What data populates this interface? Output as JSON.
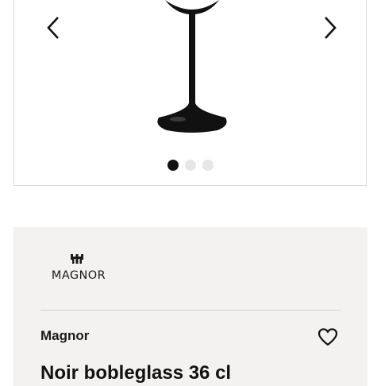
{
  "gallery": {
    "image_count": 3,
    "active_index": 0,
    "prev_icon": "chevron-left-icon",
    "next_icon": "chevron-right-icon"
  },
  "product": {
    "logo_text": "MAGNOR",
    "brand": "Magnor",
    "title": "Noir bobleglass 36 cl",
    "favorite_icon": "heart-outline-icon"
  },
  "colors": {
    "card_background": "#f4f2f1",
    "dot_active": "#111111",
    "dot_inactive": "#e6e6e6"
  }
}
